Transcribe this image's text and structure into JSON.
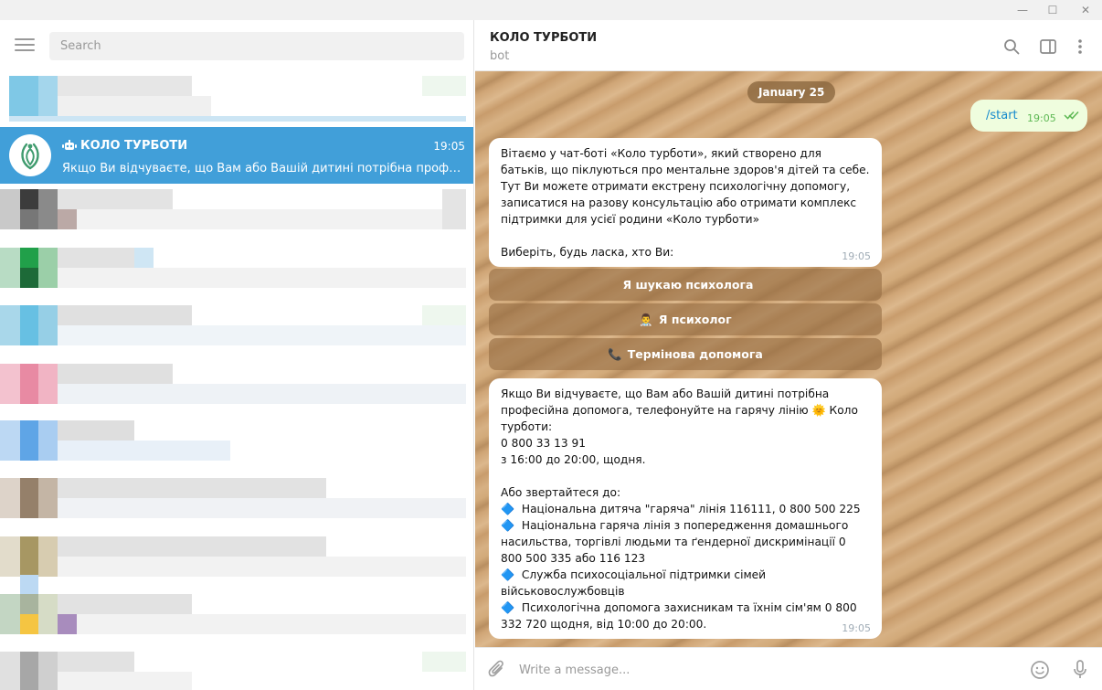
{
  "window": {
    "minimize": "—",
    "maximize": "☐",
    "close": "✕"
  },
  "sidebar": {
    "search_placeholder": "Search",
    "active_chat": {
      "name": "КОЛО ТУРБОТИ",
      "time": "19:05",
      "preview": "Якщо Ви відчуваєте, що Вам або Вашій дитині потрібна професійна допомога, телефонуйте на гарячу лінію"
    }
  },
  "header": {
    "title": "КОЛО ТУРБОТИ",
    "subtitle": "bot"
  },
  "messages": {
    "date": "January 25",
    "outgoing": {
      "text": "/start",
      "time": "19:05"
    },
    "welcome": {
      "text": "Вітаємо у чат-боті «Коло турботи», який створено для батьків, що піклуються про ментальне здоров'я дітей та себе. Тут Ви можете отримати екстрену психологічну допомогу, записатися на разову консультацію або отримати комплекс підтримки для усієї родини «Коло турботи»\n\nВиберіть, будь ласка, хто Ви:",
      "time": "19:05"
    },
    "buttons": [
      {
        "icon": "",
        "label": "Я шукаю психолога"
      },
      {
        "icon": "👨‍⚕️",
        "label": "Я психолог"
      },
      {
        "icon": "📞",
        "label": "Термінова допомога"
      }
    ],
    "hotline": {
      "text": "Якщо Ви відчуваєте, що Вам або Вашій дитині потрібна професійна допомога, телефонуйте на гарячу лінію 🌞 Коло турботи:\n0 800 33 13 91\nз 16:00 до 20:00, щодня.\n\nАбо звертайтеся до:\n🔷  Національна дитяча \"гаряча\" лінія 116111, 0 800 500 225\n🔷  Національна гаряча лінія з попередження домашнього насильства, торгівлі людьми та ґендерної дискримінації 0 800 500 335 або 116 123\n🔷  Служба психосоціальної підтримки сімей військовослужбовців\n🔷  Психологічна допомога захисникам та їхнім сім'ям 0 800 332 720 щодня, від 10:00 до 20:00.",
      "time": "19:05"
    }
  },
  "composer": {
    "placeholder": "Write a message..."
  },
  "colors": {
    "accent": "#419fd9",
    "outgoing_bubble": "#effdde",
    "button_bg": "#966e44"
  }
}
